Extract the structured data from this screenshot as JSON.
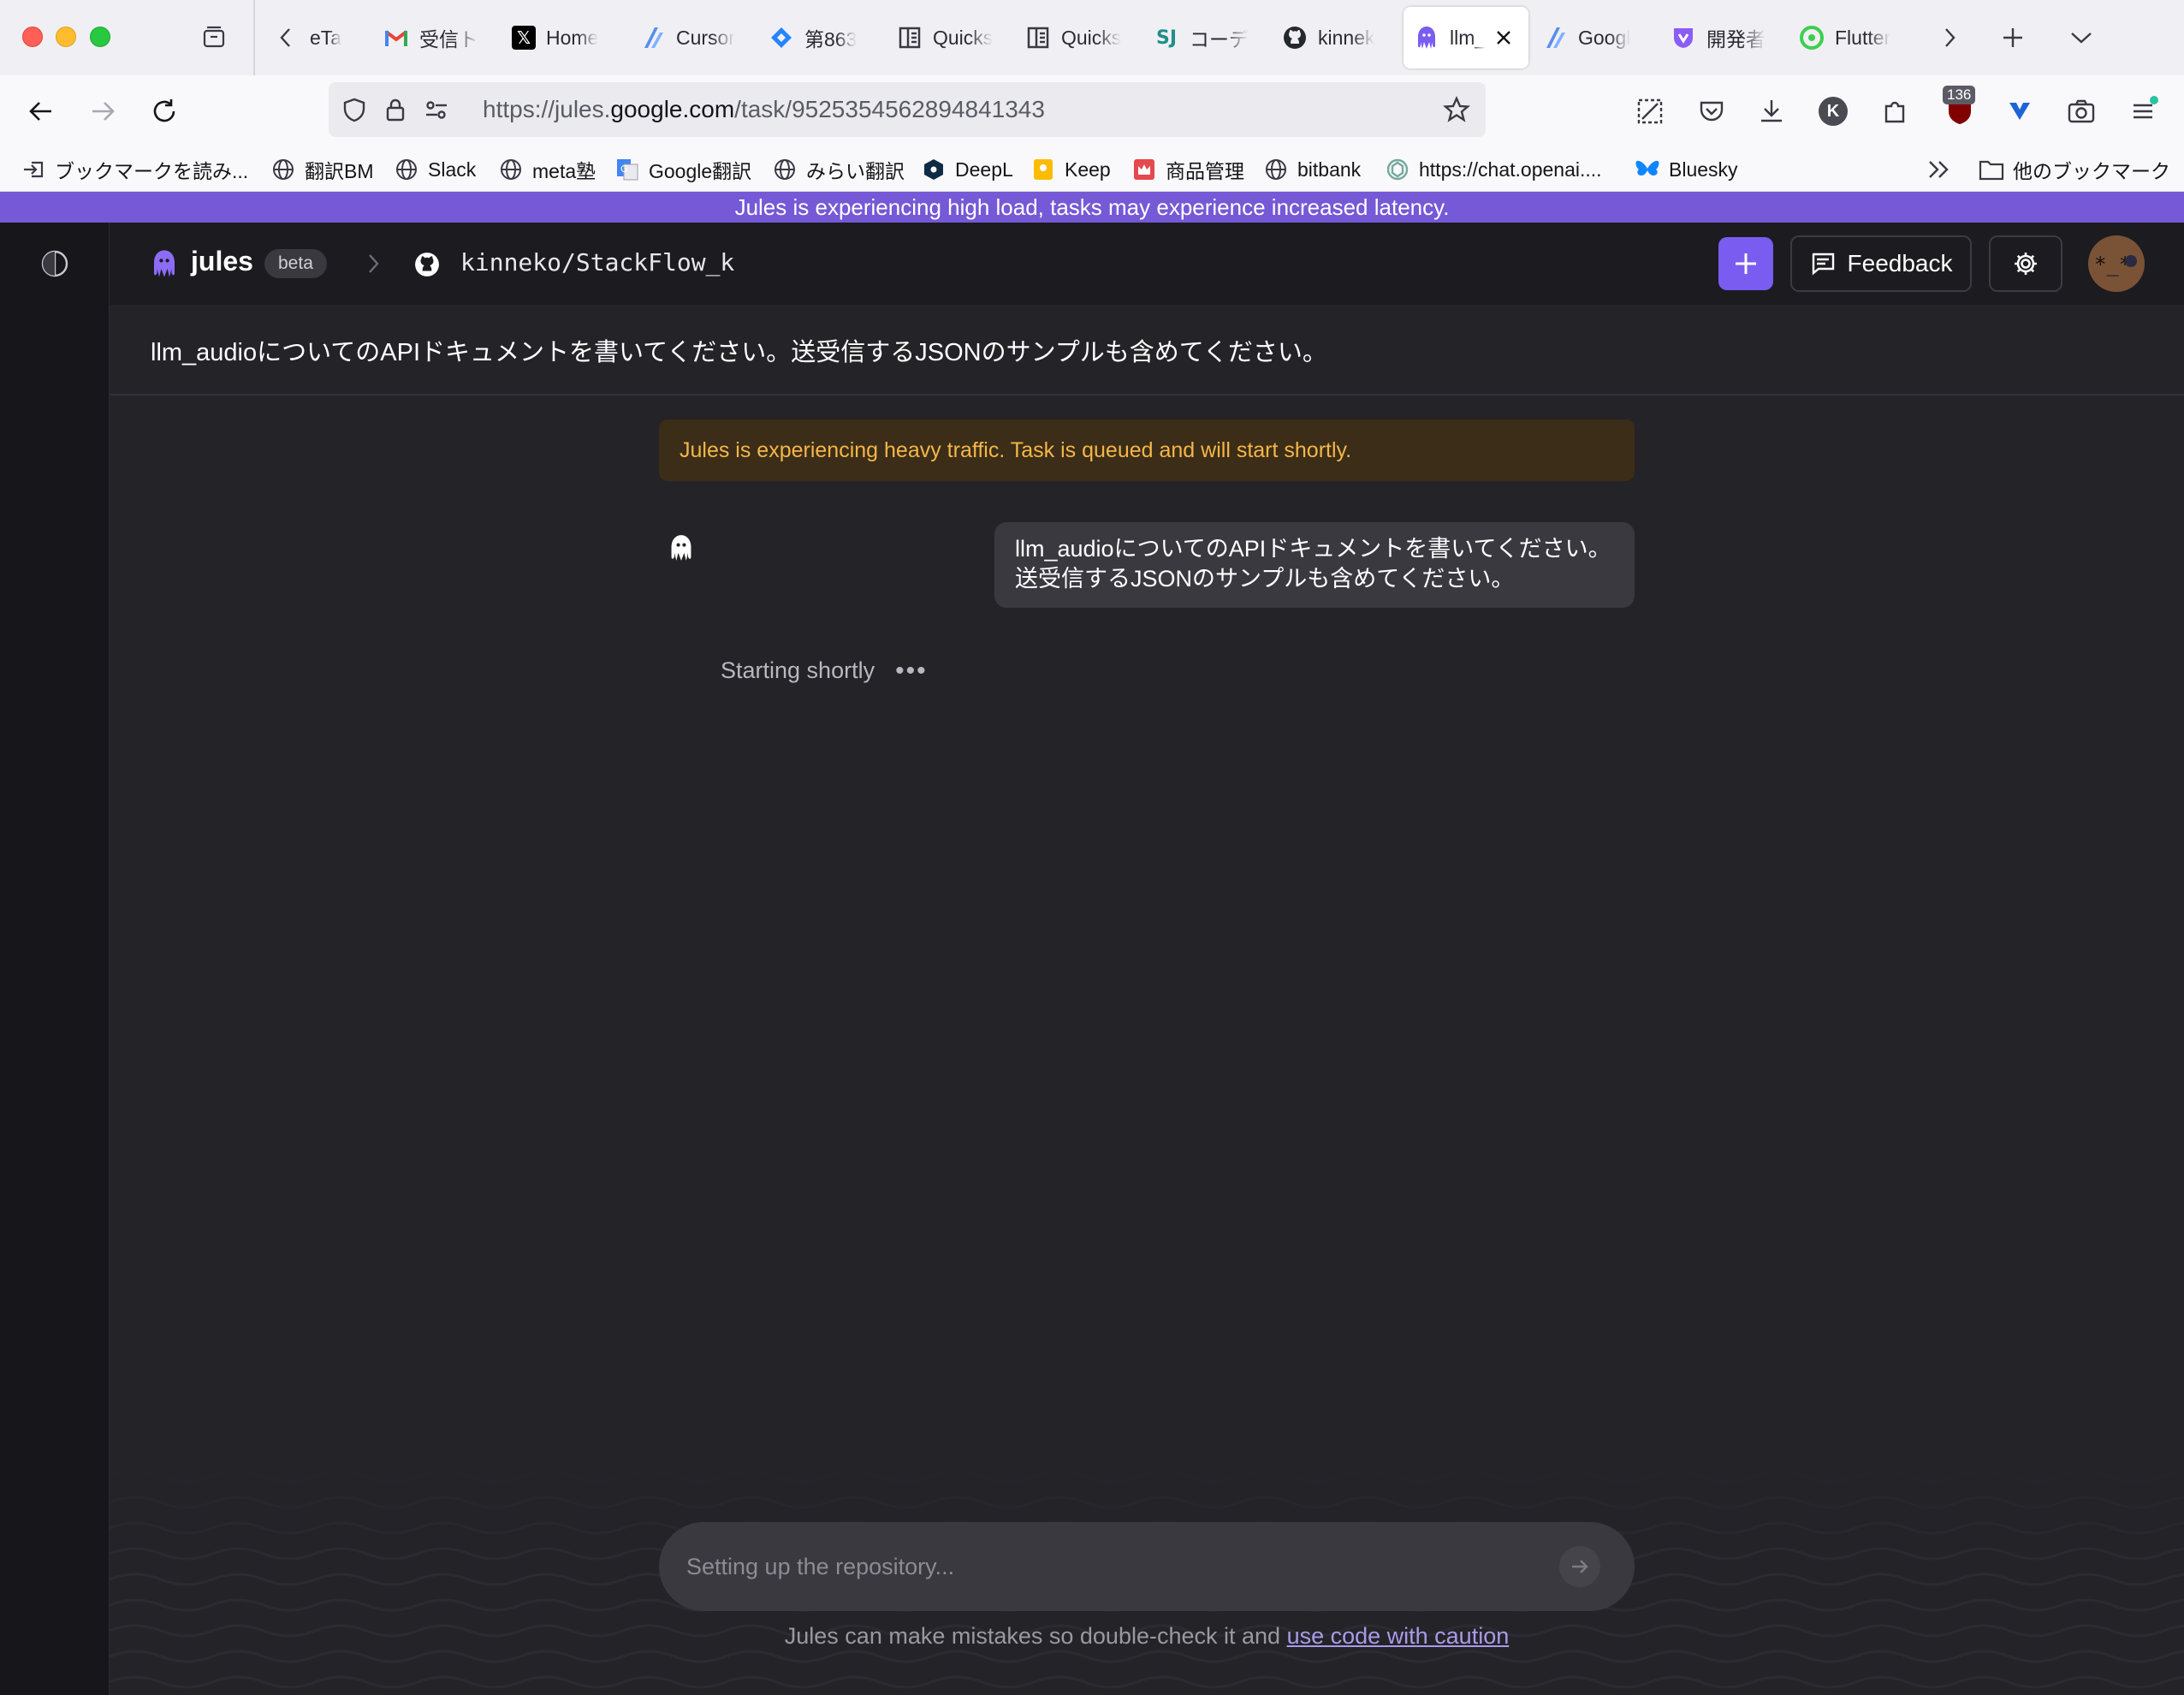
{
  "browser": {
    "tabs": [
      {
        "label": "eTa",
        "icon": "partial-tab-icon"
      },
      {
        "label": "受信ト",
        "icon": "gmail-icon"
      },
      {
        "label": "Home",
        "icon": "x-logo-icon"
      },
      {
        "label": "Cursor",
        "icon": "flutterflow-icon"
      },
      {
        "label": "第863",
        "icon": "jira-icon"
      },
      {
        "label": "Quicks",
        "icon": "quicksight-icon"
      },
      {
        "label": "Quicks",
        "icon": "quicksight-icon"
      },
      {
        "label": "コーデ",
        "icon": "sj-icon"
      },
      {
        "label": "kinnek",
        "icon": "github-icon"
      },
      {
        "label": "llm_",
        "icon": "jules-icon",
        "active": true
      },
      {
        "label": "Googl",
        "icon": "flutterflow-icon"
      },
      {
        "label": "開発者",
        "icon": "developer-icon"
      },
      {
        "label": "Flutter",
        "icon": "flutter-green-icon"
      }
    ],
    "url": {
      "prefix": "https://jules.",
      "domain": "google.com",
      "path": "/task/9525354562894841343"
    },
    "extension_badge": "136",
    "profile_initial": "K",
    "bookmarks": [
      {
        "label": "ブックマークを読み...",
        "icon": "import-bookmarks-icon"
      },
      {
        "label": "翻訳BM",
        "icon": "globe-icon"
      },
      {
        "label": "Slack",
        "icon": "globe-icon"
      },
      {
        "label": "meta塾",
        "icon": "globe-icon"
      },
      {
        "label": "Google翻訳",
        "icon": "google-translate-icon"
      },
      {
        "label": "みらい翻訳",
        "icon": "globe-icon"
      },
      {
        "label": "DeepL",
        "icon": "deepl-icon"
      },
      {
        "label": "Keep",
        "icon": "keep-icon"
      },
      {
        "label": "商品管理",
        "icon": "shop-icon"
      },
      {
        "label": "bitbank",
        "icon": "globe-icon"
      },
      {
        "label": "https://chat.openai....",
        "icon": "openai-icon"
      },
      {
        "label": "Bluesky",
        "icon": "bluesky-icon"
      }
    ],
    "other_bookmarks": "他のブックマーク"
  },
  "banner": {
    "text": "Jules is experiencing high load, tasks may experience increased latency."
  },
  "header": {
    "app_name": "jules",
    "badge": "beta",
    "repo": "kinneko/StackFlow_k",
    "feedback_label": "Feedback"
  },
  "task": {
    "prompt": "llm_audioについてのAPIドキュメントを書いてください。送受信するJSONのサンプルも含めてください。",
    "queue_warning": "Jules is experiencing heavy traffic. Task is queued and will start shortly.",
    "user_message": "llm_audioについてのAPIドキュメントを書いてください。送受信するJSONのサンプルも含めてください。",
    "status": "Starting shortly",
    "status_dots": "•••"
  },
  "composer": {
    "placeholder": "Setting up the repository..."
  },
  "disclaimer": {
    "text": "Jules can make mistakes so double-check it and ",
    "link": "use code with caution"
  },
  "colors": {
    "accent": "#7b5cf0",
    "banner": "#7559d6",
    "warning_text": "#f4b64a",
    "warning_bg": "#3b2d17",
    "page_bg": "#242328"
  }
}
